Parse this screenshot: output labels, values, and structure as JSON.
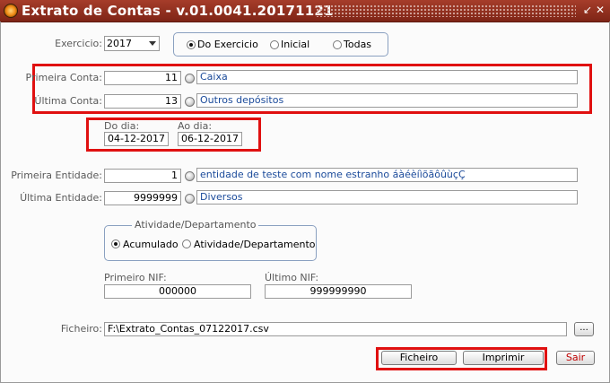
{
  "window": {
    "title": "Extrato de Contas - v.01.0041.20171121",
    "min_glyph": "↙",
    "close_glyph": "✕"
  },
  "exercicio": {
    "label": "Exercicio:",
    "value": "2017",
    "options": [
      "Do Exercicio",
      "Inicial",
      "Todas"
    ],
    "selected": "Do Exercicio"
  },
  "contas": {
    "primeira": {
      "label": "Primeira Conta:",
      "code": "11",
      "desc": "Caixa"
    },
    "ultima": {
      "label": "Última Conta:",
      "code": "13",
      "desc": "Outros depósitos"
    }
  },
  "datas": {
    "do_dia": {
      "label": "Do dia:",
      "value": "04-12-2017"
    },
    "ao_dia": {
      "label": "Ao dia:",
      "value": "06-12-2017"
    }
  },
  "entidades": {
    "primeira": {
      "label": "Primeira Entidade:",
      "code": "1",
      "desc": "entidade de teste com nome estranho áàéèíìõãôûùçÇ"
    },
    "ultima": {
      "label": "Última Entidade:",
      "code": "9999999",
      "desc": "Diversos"
    }
  },
  "atividade": {
    "legend": "Atividade/Departamento",
    "options": [
      "Acumulado",
      "Atividade/Departamento"
    ],
    "selected": "Acumulado"
  },
  "nif": {
    "primeiro": {
      "label": "Primeiro NIF:",
      "value": "000000"
    },
    "ultimo": {
      "label": "Último NIF:",
      "value": "999999990"
    }
  },
  "ficheiro": {
    "label": "Ficheiro:",
    "value": "F:\\Extrato_Contas_07122017.csv",
    "browse_label": "..."
  },
  "buttons": {
    "ficheiro": "Ficheiro",
    "imprimir": "Imprimir",
    "sair": "Sair"
  },
  "colors": {
    "titlebar": "#8e2d1d",
    "highlight": "#e01010",
    "description_text": "#1a4a9a",
    "sair_text": "#c00000"
  }
}
